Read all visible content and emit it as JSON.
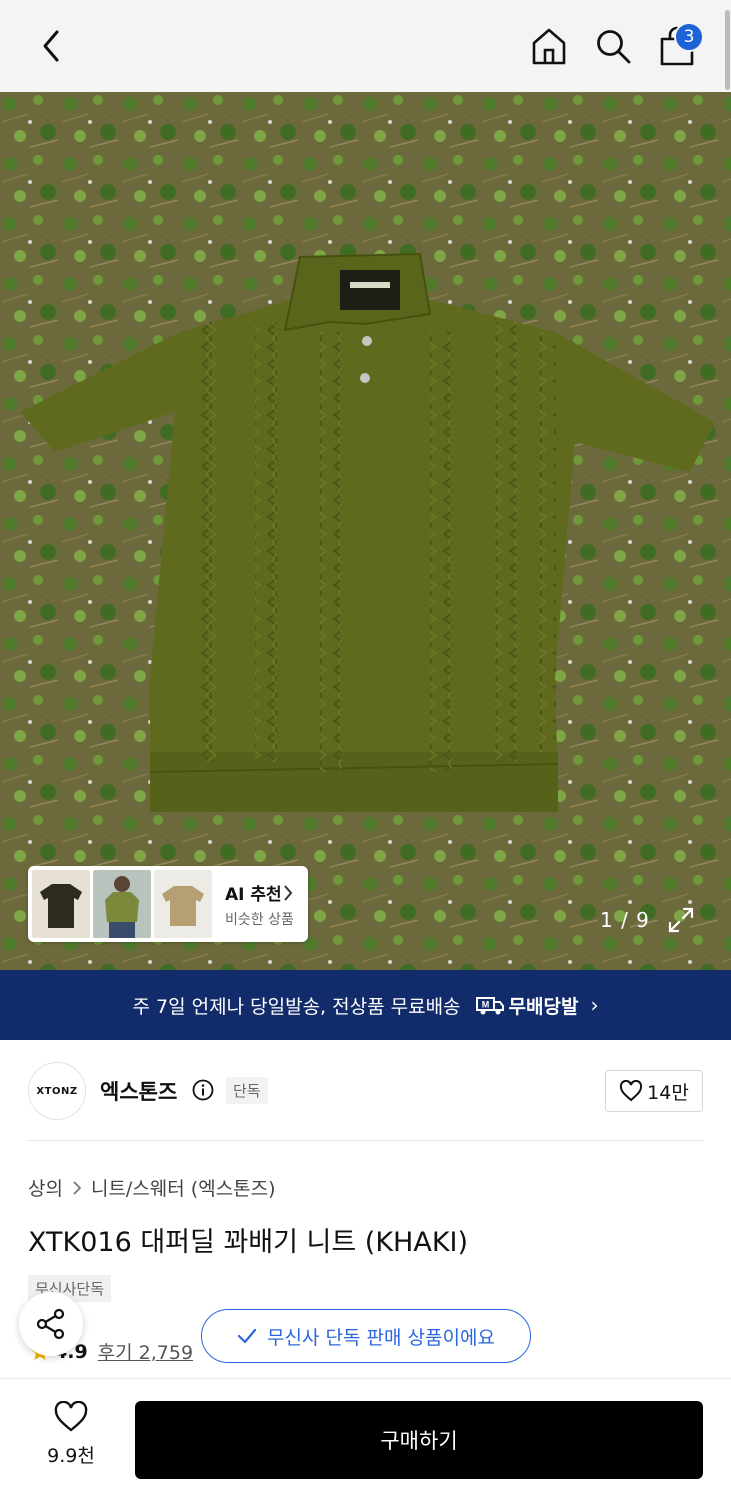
{
  "header": {
    "back_icon": "chevron-left-icon",
    "home_icon": "home-icon",
    "search_icon": "search-icon",
    "cart_icon": "shopping-bag-icon",
    "cart_count": "3"
  },
  "gallery": {
    "counter": "1 / 9",
    "expand_icon": "expand-icon",
    "ai_card": {
      "title": "AI 추천",
      "subtitle": "비슷한 상품"
    }
  },
  "banner": {
    "text": "주 7일 언제나 당일발송, 전상품 무료배송",
    "brand_label": "무배당발",
    "brand_icon": "delivery-truck-icon",
    "chevron": "›"
  },
  "brand": {
    "logo_text": "XTONZ",
    "name": "엑스톤즈",
    "exclusive_badge": "단독",
    "like_count": "14만"
  },
  "product": {
    "breadcrumb": [
      "상의",
      "니트/스웨터 (엑스톤즈)"
    ],
    "title": "XTK016 대퍼딜 꽈배기 니트 (KHAKI)",
    "tag": "무신사단독",
    "rating_score": "4.9",
    "review_label": "후기 2,759"
  },
  "toast": {
    "text": "무신사 단독 판매 상품이에요"
  },
  "bottom": {
    "wish_count": "9.9천",
    "buy_label": "구매하기"
  },
  "colors": {
    "banner_bg": "#122b6b",
    "accent_blue": "#2b66e0",
    "badge_blue": "#1e63d6",
    "buy_bg": "#000000",
    "sweater_khaki": "#5f6a1f"
  }
}
